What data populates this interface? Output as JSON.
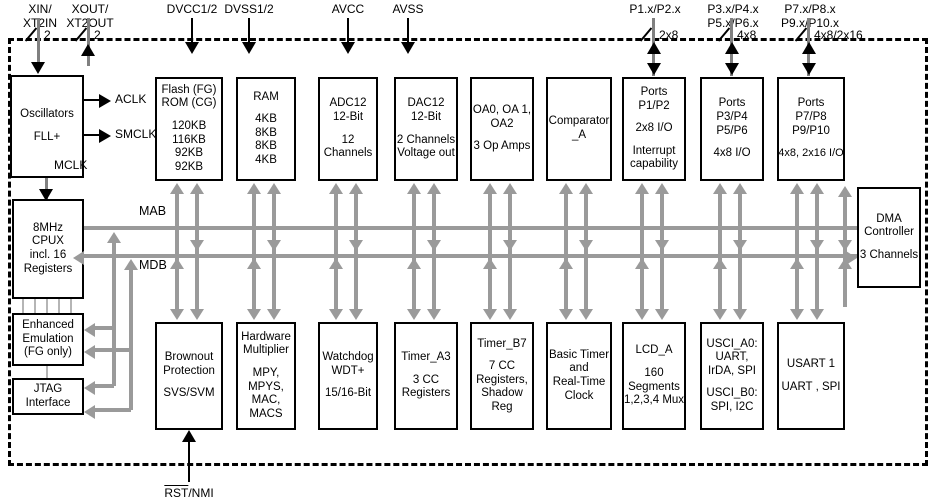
{
  "title": "MSP430 Microcontroller Functional Block Diagram",
  "pins": {
    "xin": {
      "lines": [
        "XIN/",
        "XT2IN"
      ],
      "width": "2"
    },
    "xout": {
      "lines": [
        "XOUT/",
        "XT2OUT"
      ],
      "width": "2"
    },
    "dvcc": {
      "lines": [
        "DVCC1/2"
      ]
    },
    "dvss": {
      "lines": [
        "DVSS1/2"
      ]
    },
    "avcc": {
      "lines": [
        "AVCC"
      ]
    },
    "avss": {
      "lines": [
        "AVSS"
      ]
    },
    "p12": {
      "lines": [
        "P1.x/P2.x"
      ],
      "width": "2x8"
    },
    "p3456": {
      "lines": [
        "P3.x/P4.x",
        "P5.x/P6.x"
      ],
      "width": "4x8"
    },
    "p78910": {
      "lines": [
        "P7.x/P8.x",
        "P9.x/P10.x"
      ],
      "width": "4x8/2x16"
    },
    "rst": {
      "overline": "RST",
      "rest": "/NMI"
    }
  },
  "clocks": {
    "aclk": "ACLK",
    "smclk": "SMCLK",
    "mclk": "MCLK"
  },
  "buses": {
    "mab": "MAB",
    "mdb": "MDB"
  },
  "blocks": {
    "oscillators": {
      "lines": [
        "Oscillators",
        "",
        "FLL+"
      ]
    },
    "cpu": {
      "lines": [
        "8MHz",
        "CPUX",
        "incl. 16",
        "Registers"
      ]
    },
    "emulation": {
      "lines": [
        "Enhanced",
        "Emulation",
        "(FG only)"
      ]
    },
    "jtag": {
      "lines": [
        "JTAG",
        "Interface"
      ]
    },
    "flash": {
      "head": [
        "Flash (FG)",
        "ROM (CG)"
      ],
      "body": [
        "120KB",
        "116KB",
        "92KB",
        "92KB"
      ]
    },
    "ram": {
      "head": [
        "RAM"
      ],
      "body": [
        "4KB",
        "8KB",
        "8KB",
        "4KB"
      ]
    },
    "adc12": {
      "head": [
        "ADC12",
        "12-Bit"
      ],
      "body": [
        "12",
        "Channels"
      ]
    },
    "dac12": {
      "head": [
        "DAC12",
        "12-Bit"
      ],
      "body": [
        "2 Channels",
        "Voltage out"
      ]
    },
    "opamps": {
      "head": [
        "OA0, OA 1,",
        "OA2"
      ],
      "body": [
        "3 Op Amps"
      ]
    },
    "comparator": {
      "head": [
        "Comparator",
        "_A"
      ],
      "body": []
    },
    "ports12": {
      "head": [
        "Ports",
        "P1/P2"
      ],
      "body": [
        "2x8 I/O",
        "",
        "Interrupt",
        "capability"
      ]
    },
    "ports3456": {
      "head": [
        "Ports",
        "P3/P4",
        "P5/P6"
      ],
      "body": [
        "4x8 I/O"
      ]
    },
    "ports78910": {
      "head": [
        "Ports",
        "P7/P8",
        "P9/P10"
      ],
      "body": [
        "4x8, 2x16 I/O"
      ]
    },
    "dma": {
      "head": [
        "DMA",
        "Controller"
      ],
      "body": [
        "3 Channels"
      ]
    },
    "brownout": {
      "head": [
        "Brownout",
        "Protection"
      ],
      "body": [
        "SVS/SVM"
      ]
    },
    "multiplier": {
      "head": [
        "Hardware",
        "Multiplier"
      ],
      "body": [
        "MPY,",
        "MPYS,",
        "MAC,",
        "MACS"
      ]
    },
    "watchdog": {
      "head": [
        "Watchdog",
        "WDT+"
      ],
      "body": [
        "15/16-Bit"
      ]
    },
    "timera3": {
      "head": [
        "Timer_A3"
      ],
      "body": [
        "3 CC",
        "Registers"
      ]
    },
    "timerb7": {
      "head": [
        "Timer_B7"
      ],
      "body": [
        "7 CC",
        "Registers,",
        "Shadow",
        "Reg"
      ]
    },
    "basictimer": {
      "head": [
        "Basic Timer",
        "and",
        "Real-Time",
        "Clock"
      ],
      "body": []
    },
    "lcd": {
      "head": [
        "LCD_A"
      ],
      "body": [
        "160",
        "Segments",
        "1,2,3,4 Mux"
      ]
    },
    "usci": {
      "head": [
        "USCI_A0:",
        "UART,",
        "IrDA, SPI"
      ],
      "body": [
        "USCI_B0:",
        "SPI, I2C"
      ]
    },
    "usart1": {
      "head": [
        "USART 1"
      ],
      "body": [
        "UART , SPI"
      ]
    }
  },
  "colors": {
    "bus": "#9a9a9a",
    "outline": "#000000",
    "background": "#ffffff"
  }
}
